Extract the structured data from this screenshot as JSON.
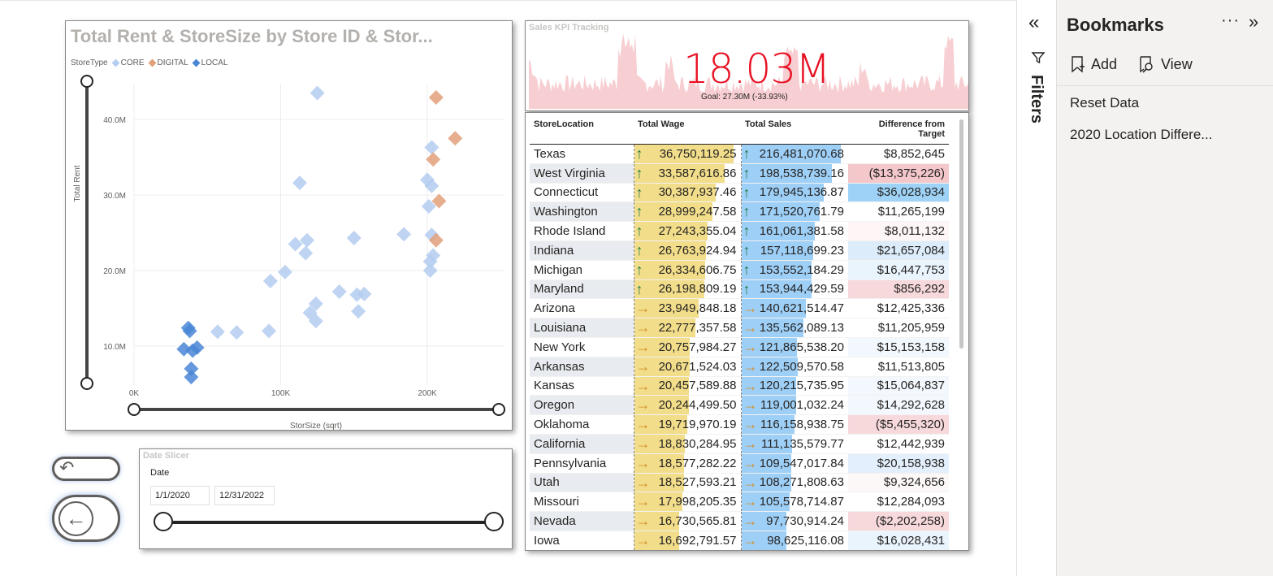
{
  "scatter": {
    "title": "Total Rent & StoreSize by Store ID & Stor...",
    "legend_title": "StoreType",
    "legend": [
      {
        "name": "CORE",
        "color": "#b4cdf0"
      },
      {
        "name": "DIGITAL",
        "color": "#e2a07a"
      },
      {
        "name": "LOCAL",
        "color": "#4a86d6"
      }
    ],
    "xlabel": "StorSize (sqrt)",
    "ylabel": "Total Rent"
  },
  "chart_data": {
    "type": "scatter",
    "title": "Total Rent & StoreSize by Store ID & Stor...",
    "xlabel": "StorSize (sqrt)",
    "ylabel": "Total Rent",
    "x_ticks": [
      "0K",
      "100K",
      "200K"
    ],
    "y_ticks": [
      "10.0M",
      "20.0M",
      "30.0M",
      "40.0M"
    ],
    "xlim": [
      0,
      240000
    ],
    "ylim": [
      5000000,
      45000000
    ],
    "grid": true,
    "legend_position": "top-left",
    "series": [
      {
        "name": "CORE",
        "color": "#b4cdf0",
        "points": [
          [
            125000,
            43500000
          ],
          [
            113000,
            31600000
          ],
          [
            110000,
            23500000
          ],
          [
            118000,
            24000000
          ],
          [
            117000,
            22300000
          ],
          [
            150000,
            24300000
          ],
          [
            184000,
            24800000
          ],
          [
            93000,
            18600000
          ],
          [
            103000,
            19800000
          ],
          [
            140000,
            17200000
          ],
          [
            124000,
            15600000
          ],
          [
            120000,
            14400000
          ],
          [
            124000,
            13300000
          ],
          [
            152000,
            16800000
          ],
          [
            157000,
            16900000
          ],
          [
            153000,
            14600000
          ],
          [
            92000,
            12000000
          ],
          [
            57000,
            11900000
          ],
          [
            70000,
            11800000
          ],
          [
            200000,
            32000000
          ],
          [
            203000,
            31200000
          ],
          [
            201000,
            28500000
          ],
          [
            203000,
            24700000
          ],
          [
            204000,
            22000000
          ],
          [
            202000,
            21200000
          ],
          [
            202000,
            20000000
          ],
          [
            203000,
            36300000
          ]
        ]
      },
      {
        "name": "DIGITAL",
        "color": "#e2a07a",
        "points": [
          [
            206000,
            42900000
          ],
          [
            219000,
            37500000
          ],
          [
            204000,
            34700000
          ],
          [
            208000,
            29200000
          ],
          [
            206000,
            24000000
          ]
        ]
      },
      {
        "name": "LOCAL",
        "color": "#4a86d6",
        "points": [
          [
            37000,
            12400000
          ],
          [
            38000,
            12000000
          ],
          [
            34000,
            9600000
          ],
          [
            40000,
            9400000
          ],
          [
            43000,
            9800000
          ],
          [
            39000,
            7000000
          ],
          [
            39000,
            5900000
          ]
        ]
      }
    ]
  },
  "kpi": {
    "title": "Sales KPI Tracking",
    "value": "18.03M",
    "goal": "Goal: 27.30M (-33.93%)"
  },
  "table": {
    "headers": [
      "StoreLocation",
      "Total Wage",
      "Total Sales",
      "Difference from Target"
    ],
    "rows": [
      {
        "loc": "Texas",
        "wage": "36,750,119.25",
        "sales": "216,481,070.68",
        "diff": "$8,852,645",
        "arrow": "up",
        "wpct": 1.0,
        "spct": 1.0,
        "dcolor": "#ffffff"
      },
      {
        "loc": "West Virginia",
        "wage": "33,587,616.86",
        "sales": "198,538,739.16",
        "diff": "($13,375,226)",
        "arrow": "up",
        "wpct": 0.914,
        "spct": 0.917,
        "dcolor": "#f4c7cb"
      },
      {
        "loc": "Connecticut",
        "wage": "30,387,937.46",
        "sales": "179,945,136.87",
        "diff": "$36,028,934",
        "arrow": "up",
        "wpct": 0.827,
        "spct": 0.831,
        "dcolor": "#9ed3f7"
      },
      {
        "loc": "Washington",
        "wage": "28,999,247.58",
        "sales": "171,520,761.79",
        "diff": "$11,265,199",
        "arrow": "up",
        "wpct": 0.789,
        "spct": 0.792,
        "dcolor": "#ffffff"
      },
      {
        "loc": "Rhode Island",
        "wage": "27,243,355.04",
        "sales": "161,061,381.58",
        "diff": "$8,011,132",
        "arrow": "up",
        "wpct": 0.741,
        "spct": 0.744,
        "dcolor": "#fdf5f6"
      },
      {
        "loc": "Indiana",
        "wage": "26,763,924.94",
        "sales": "157,118,699.23",
        "diff": "$21,657,084",
        "arrow": "up",
        "wpct": 0.728,
        "spct": 0.726,
        "dcolor": "#dcecfb"
      },
      {
        "loc": "Michigan",
        "wage": "26,334,606.75",
        "sales": "153,552,184.29",
        "diff": "$16,447,753",
        "arrow": "up",
        "wpct": 0.717,
        "spct": 0.709,
        "dcolor": "#eaf4fd"
      },
      {
        "loc": "Maryland",
        "wage": "26,198,809.19",
        "sales": "153,944,429.59",
        "diff": "$856,292",
        "arrow": "up",
        "wpct": 0.713,
        "spct": 0.711,
        "dcolor": "#f7d9dc"
      },
      {
        "loc": "Arizona",
        "wage": "23,949,848.18",
        "sales": "140,621,514.47",
        "diff": "$12,425,336",
        "arrow": "right",
        "wpct": 0.652,
        "spct": 0.65,
        "dcolor": "#ffffff"
      },
      {
        "loc": "Louisiana",
        "wage": "22,777,357.58",
        "sales": "135,562,089.13",
        "diff": "$11,205,959",
        "arrow": "right",
        "wpct": 0.62,
        "spct": 0.626,
        "dcolor": "#ffffff"
      },
      {
        "loc": "New York",
        "wage": "20,757,984.27",
        "sales": "121,865,538.20",
        "diff": "$15,153,158",
        "arrow": "right",
        "wpct": 0.565,
        "spct": 0.563,
        "dcolor": "#f2f8fe"
      },
      {
        "loc": "Arkansas",
        "wage": "20,671,524.03",
        "sales": "122,509,570.58",
        "diff": "$11,513,805",
        "arrow": "right",
        "wpct": 0.562,
        "spct": 0.566,
        "dcolor": "#ffffff"
      },
      {
        "loc": "Kansas",
        "wage": "20,457,589.88",
        "sales": "120,215,735.95",
        "diff": "$15,064,837",
        "arrow": "right",
        "wpct": 0.557,
        "spct": 0.555,
        "dcolor": "#f2f8fe"
      },
      {
        "loc": "Oregon",
        "wage": "20,244,499.50",
        "sales": "119,001,032.24",
        "diff": "$14,292,628",
        "arrow": "right",
        "wpct": 0.551,
        "spct": 0.55,
        "dcolor": "#f2f8fe"
      },
      {
        "loc": "Oklahoma",
        "wage": "19,719,970.19",
        "sales": "116,158,938.75",
        "diff": "($5,455,320)",
        "arrow": "right",
        "wpct": 0.537,
        "spct": 0.537,
        "dcolor": "#f7d9dc"
      },
      {
        "loc": "California",
        "wage": "18,830,284.95",
        "sales": "111,135,579.77",
        "diff": "$12,442,939",
        "arrow": "right",
        "wpct": 0.512,
        "spct": 0.513,
        "dcolor": "#ffffff"
      },
      {
        "loc": "Pennsylvania",
        "wage": "18,577,282.22",
        "sales": "109,547,017.84",
        "diff": "$20,158,938",
        "arrow": "right",
        "wpct": 0.506,
        "spct": 0.506,
        "dcolor": "#e3effc"
      },
      {
        "loc": "Utah",
        "wage": "18,527,593.21",
        "sales": "108,271,808.63",
        "diff": "$9,324,656",
        "arrow": "right",
        "wpct": 0.504,
        "spct": 0.5,
        "dcolor": "#fdf8f8"
      },
      {
        "loc": "Missouri",
        "wage": "17,998,205.35",
        "sales": "105,578,714.87",
        "diff": "$12,284,093",
        "arrow": "right",
        "wpct": 0.49,
        "spct": 0.488,
        "dcolor": "#ffffff"
      },
      {
        "loc": "Nevada",
        "wage": "16,730,565.81",
        "sales": "97,730,914.24",
        "diff": "($2,202,258)",
        "arrow": "right",
        "wpct": 0.455,
        "spct": 0.451,
        "dcolor": "#f7d9dc"
      },
      {
        "loc": "Iowa",
        "wage": "16,692,791.57",
        "sales": "98,625,116.08",
        "diff": "$16,028,431",
        "arrow": "right",
        "wpct": 0.454,
        "spct": 0.456,
        "dcolor": "#eaf4fd"
      }
    ]
  },
  "slicer": {
    "title": "Date Slicer",
    "label": "Date",
    "from": "1/1/2020",
    "to": "12/31/2022"
  },
  "filters": {
    "label": "Filters"
  },
  "bookmarks": {
    "title": "Bookmarks",
    "more": "···",
    "add_label": "Add",
    "view_label": "View",
    "items": [
      "Reset Data",
      "2020 Location Differe..."
    ]
  }
}
